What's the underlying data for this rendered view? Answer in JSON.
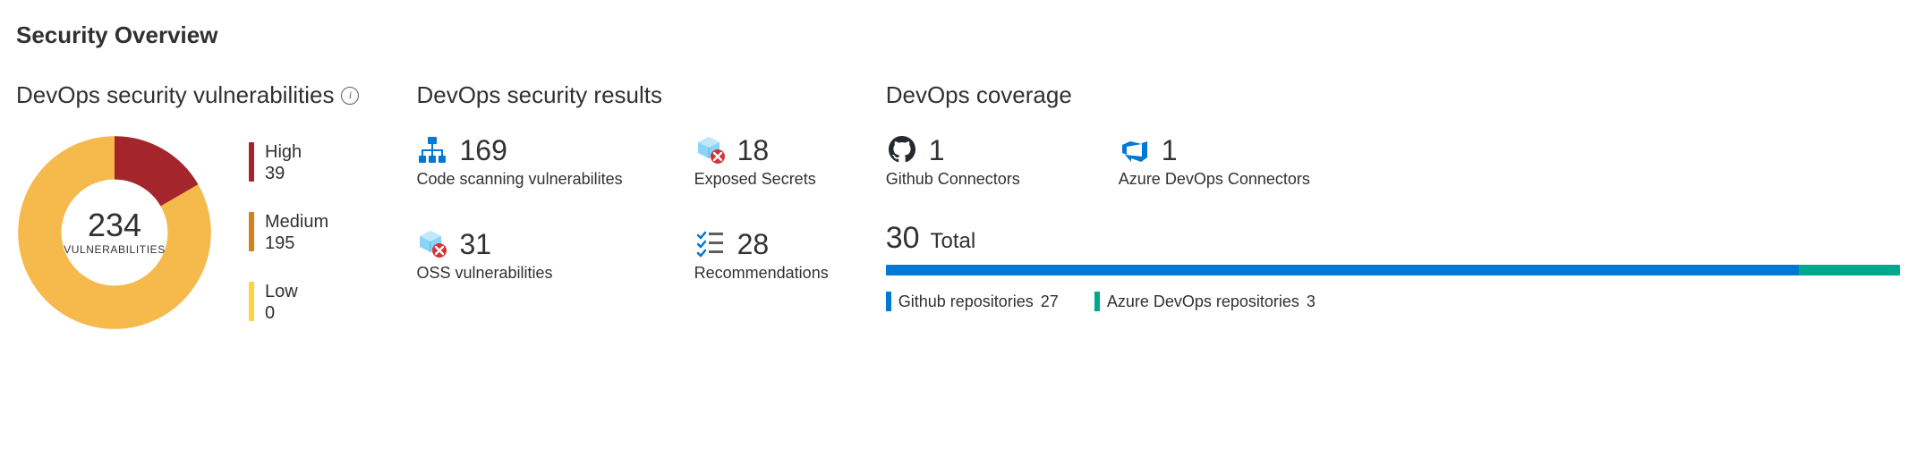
{
  "colors": {
    "high": "#a4262c",
    "medium": "#d67f1b",
    "low": "#ffd23f",
    "donut": "#f5b94c",
    "azureBlue": "#0078d4",
    "teal": "#00a88f",
    "checkBlue": "#0078d4",
    "grey": "#605e5c"
  },
  "title": "Security Overview",
  "vulnerabilities": {
    "title": "DevOps security vulnerabilities",
    "center_value": "234",
    "center_label": "VULNERABILITIES",
    "legend": {
      "high": {
        "label": "High",
        "value": "39"
      },
      "medium": {
        "label": "Medium",
        "value": "195"
      },
      "low": {
        "label": "Low",
        "value": "0"
      }
    }
  },
  "results": {
    "title": "DevOps security results",
    "code_scanning": {
      "value": "169",
      "label": "Code scanning vulnerabilites"
    },
    "secrets": {
      "value": "18",
      "label": "Exposed Secrets"
    },
    "oss": {
      "value": "31",
      "label": "OSS vulnerabilities"
    },
    "recommendations": {
      "value": "28",
      "label": "Recommendations"
    }
  },
  "coverage": {
    "title": "DevOps coverage",
    "github_connectors": {
      "value": "1",
      "label": "Github Connectors"
    },
    "azure_connectors": {
      "value": "1",
      "label": "Azure DevOps Connectors"
    },
    "total": {
      "value": "30",
      "label": "Total"
    },
    "github_repos": {
      "value": "27",
      "label": "Github repositories"
    },
    "azure_repos": {
      "value": "3",
      "label": "Azure DevOps repositories"
    }
  },
  "chart_data": [
    {
      "type": "pie",
      "title": "DevOps security vulnerabilities",
      "series": [
        {
          "name": "High",
          "value": 39,
          "color": "#a4262c"
        },
        {
          "name": "Medium",
          "value": 195,
          "color": "#f5b94c"
        },
        {
          "name": "Low",
          "value": 0,
          "color": "#ffd23f"
        }
      ],
      "total": 234,
      "donut": true
    },
    {
      "type": "bar",
      "title": "DevOps coverage repositories",
      "categories": [
        "Github repositories",
        "Azure DevOps repositories"
      ],
      "values": [
        27,
        3
      ],
      "total": 30,
      "stacked_single_bar": true,
      "colors": [
        "#0078d4",
        "#00a88f"
      ]
    }
  ]
}
